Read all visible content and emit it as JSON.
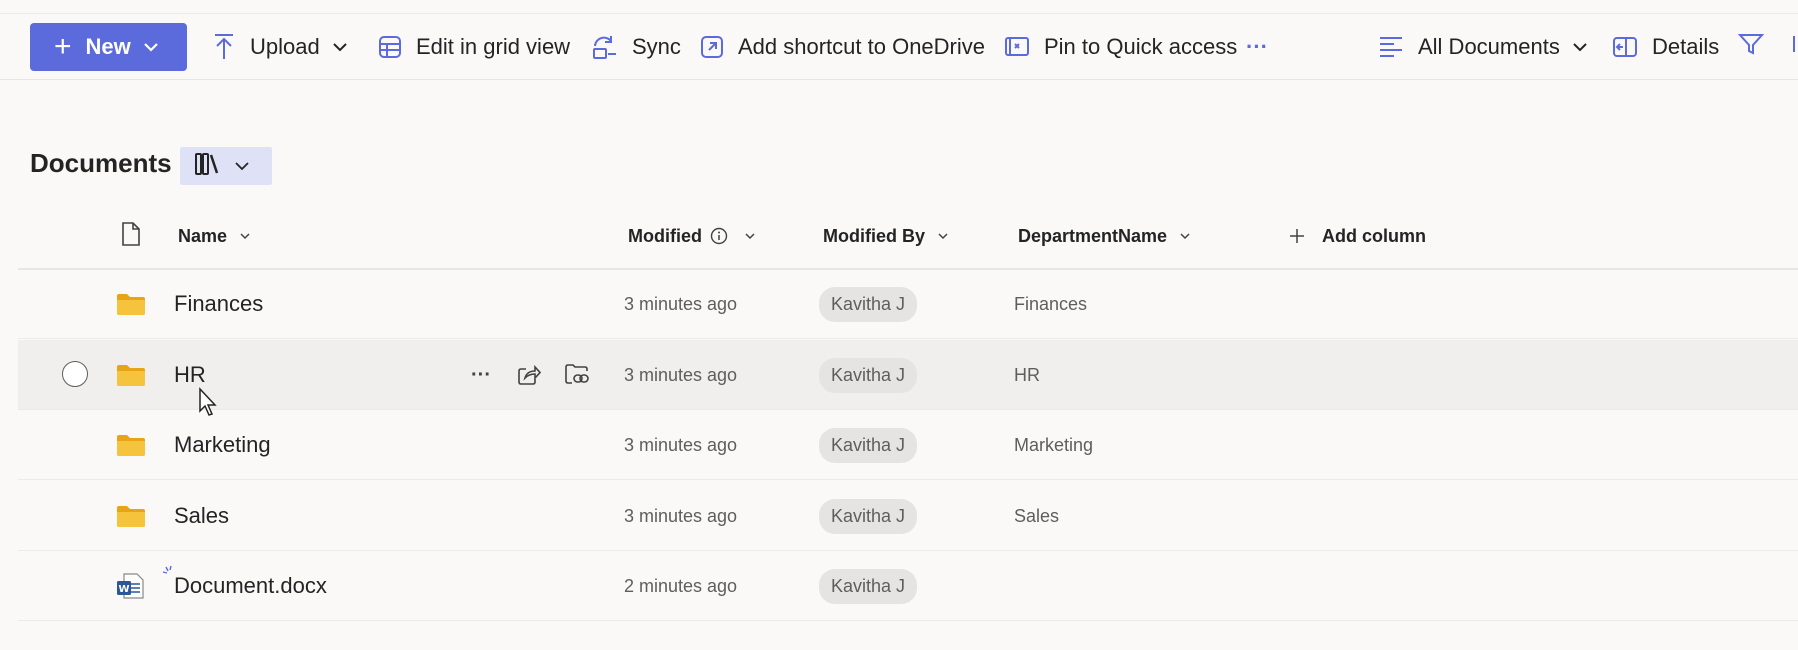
{
  "toolbar": {
    "new_label": "New",
    "upload_label": "Upload",
    "grid_label": "Edit in grid view",
    "sync_label": "Sync",
    "shortcut_label": "Add shortcut to OneDrive",
    "pin_label": "Pin to Quick access",
    "more_label": "···",
    "view_label": "All Documents",
    "details_label": "Details"
  },
  "page": {
    "title": "Documents"
  },
  "columns": {
    "name": "Name",
    "modified": "Modified",
    "modified_by": "Modified By",
    "department": "DepartmentName",
    "add_column": "Add column"
  },
  "rows": [
    {
      "name": "Finances",
      "modified": "3 minutes ago",
      "modified_by": "Kavitha J",
      "department": "Finances",
      "type": "folder"
    },
    {
      "name": "HR",
      "modified": "3 minutes ago",
      "modified_by": "Kavitha J",
      "department": "HR",
      "type": "folder"
    },
    {
      "name": "Marketing",
      "modified": "3 minutes ago",
      "modified_by": "Kavitha J",
      "department": "Marketing",
      "type": "folder"
    },
    {
      "name": "Sales",
      "modified": "3 minutes ago",
      "modified_by": "Kavitha J",
      "department": "Sales",
      "type": "folder"
    },
    {
      "name": "Document.docx",
      "modified": "2 minutes ago",
      "modified_by": "Kavitha J",
      "department": "",
      "type": "word-file"
    }
  ],
  "row_actions": {
    "more_label": "···"
  },
  "colors": {
    "accent": "#5b6bdc",
    "folder": "#f6c33c",
    "word": "#2b579a"
  }
}
